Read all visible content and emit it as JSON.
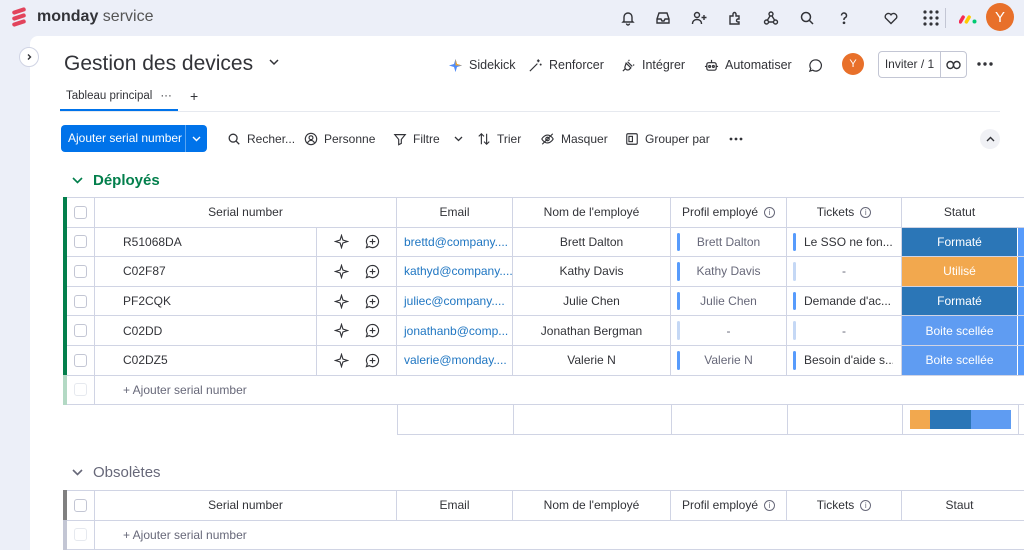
{
  "app": {
    "brand_bold": "monday",
    "brand_light": "service",
    "avatar_initial": "Y",
    "accent": "#0073ea",
    "topbar_icons": [
      "bell-icon",
      "inbox-icon",
      "invite-user-icon",
      "apps-icon",
      "integrations-icon",
      "search-icon",
      "help-icon",
      "heart-icon",
      "grid-menu-icon",
      "monday-logo-icon"
    ]
  },
  "header": {
    "title": "Gestion des devices",
    "actions": {
      "sidekick": "Sidekick",
      "renforcer": "Renforcer",
      "integrer": "Intégrer",
      "automatiser": "Automatiser"
    },
    "invite_label": "Inviter / 1",
    "tab_label": "Tableau principal",
    "tab_more": "···",
    "tab_add": "+"
  },
  "toolbar": {
    "primary_label": "Ajouter serial number",
    "search": "Recher...",
    "person": "Personne",
    "filter": "Filtre",
    "sort": "Trier",
    "hide": "Masquer",
    "group": "Grouper par",
    "more": "···"
  },
  "columns": {
    "serial": "Serial number",
    "email": "Email",
    "name": "Nom de l'employé",
    "profile": "Profil employé",
    "tickets": "Tickets",
    "status_group1": "Statut",
    "status_group2": "Staut"
  },
  "groups": [
    {
      "name": "Déployés",
      "color": "#037f4c",
      "add_label": "+ Ajouter serial number",
      "rows": [
        {
          "serial": "R51068DA",
          "email": "brettd@company....",
          "name": "Brett Dalton",
          "profile": "Brett Dalton",
          "profile_color": "#579bfc",
          "tickets": "Le SSO ne fon...",
          "tickets_color": "#579bfc",
          "status": "Formaté",
          "status_color": "#2b76b7"
        },
        {
          "serial": "C02F87",
          "email": "kathyd@company....",
          "name": "Kathy Davis",
          "profile": "Kathy Davis",
          "profile_color": "#579bfc",
          "tickets": "-",
          "tickets_color": "#c5d8f5",
          "status": "Utilisé",
          "status_color": "#f2a84e"
        },
        {
          "serial": "PF2CQK",
          "email": "juliec@company....",
          "name": "Julie Chen",
          "profile": "Julie Chen",
          "profile_color": "#579bfc",
          "tickets": "Demande d'ac...",
          "tickets_color": "#579bfc",
          "status": "Formaté",
          "status_color": "#2b76b7"
        },
        {
          "serial": "C02DD",
          "email": "jonathanb@comp...",
          "name": "Jonathan Bergman",
          "profile": "-",
          "profile_color": "#c5d8f5",
          "tickets": "-",
          "tickets_color": "#c5d8f5",
          "status": "Boite scellée",
          "status_color": "#5f9cf2"
        },
        {
          "serial": "C02DZ5",
          "email": "valerie@monday....",
          "name": "Valerie N",
          "profile": "Valerie N",
          "profile_color": "#579bfc",
          "tickets": "Besoin d'aide s...",
          "tickets_color": "#579bfc",
          "status": "Boite scellée",
          "status_color": "#5f9cf2"
        }
      ],
      "summary": [
        {
          "color": "#f2a84e",
          "fraction": 0.2
        },
        {
          "color": "#2b76b7",
          "fraction": 0.4
        },
        {
          "color": "#5f9cf2",
          "fraction": 0.4
        }
      ]
    },
    {
      "name": "Obsolètes",
      "color": "#676879",
      "add_label": "+ Ajouter serial number"
    }
  ]
}
